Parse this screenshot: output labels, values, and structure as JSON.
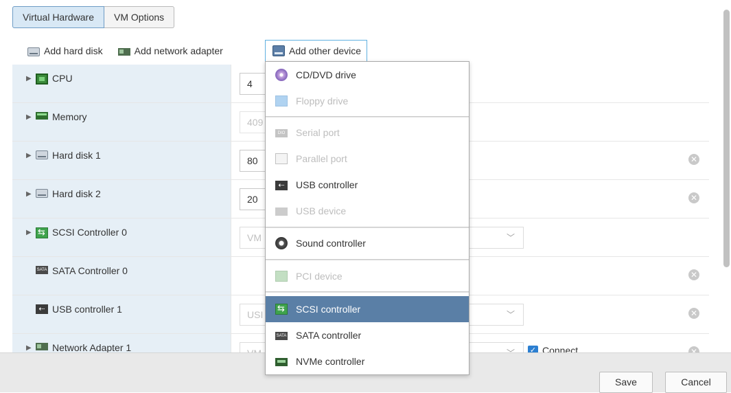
{
  "tabs": [
    {
      "label": "Virtual Hardware",
      "active": true
    },
    {
      "label": "VM Options",
      "active": false
    }
  ],
  "toolbar": {
    "add_hard_disk": "Add hard disk",
    "add_network_adapter": "Add network adapter",
    "add_other_device": "Add other device"
  },
  "hardware": [
    {
      "label": "CPU",
      "icon": "cpu-icon",
      "expandable": true,
      "value": "4"
    },
    {
      "label": "Memory",
      "icon": "memory-icon",
      "expandable": true,
      "value": "409"
    },
    {
      "label": "Hard disk 1",
      "icon": "hard-disk-icon",
      "expandable": true,
      "value": "80"
    },
    {
      "label": "Hard disk 2",
      "icon": "hard-disk-icon",
      "expandable": true,
      "value": "20"
    },
    {
      "label": "SCSI Controller 0",
      "icon": "scsi-icon",
      "expandable": true,
      "value": "VM"
    },
    {
      "label": "SATA Controller 0",
      "icon": "sata-icon",
      "expandable": false,
      "value": ""
    },
    {
      "label": "USB controller 1",
      "icon": "usb-icon",
      "expandable": false,
      "value": "USI"
    },
    {
      "label": "Network Adapter 1",
      "icon": "network-icon",
      "expandable": true,
      "value": "VM",
      "connect_label": "Connect"
    }
  ],
  "menu": {
    "items": [
      {
        "label": "CD/DVD drive",
        "icon": "cd-dvd-icon",
        "enabled": true
      },
      {
        "label": "Floppy drive",
        "icon": "floppy-icon",
        "enabled": false
      },
      {
        "label": "Serial port",
        "icon": "serial-port-icon",
        "enabled": false
      },
      {
        "label": "Parallel port",
        "icon": "parallel-port-icon",
        "enabled": false
      },
      {
        "label": "USB controller",
        "icon": "usb-icon",
        "enabled": true
      },
      {
        "label": "USB device",
        "icon": "usb-device-icon",
        "enabled": false
      },
      {
        "label": "Sound controller",
        "icon": "sound-icon",
        "enabled": true
      },
      {
        "label": "PCI device",
        "icon": "pci-icon",
        "enabled": false
      },
      {
        "label": "SCSI controller",
        "icon": "scsi-icon",
        "enabled": true,
        "selected": true
      },
      {
        "label": "SATA controller",
        "icon": "sata-icon",
        "enabled": true
      },
      {
        "label": "NVMe controller",
        "icon": "nvme-icon",
        "enabled": true
      }
    ]
  },
  "footer": {
    "save_label": "Save",
    "cancel_label": "Cancel"
  },
  "colors": {
    "accent": "#5a7fa6",
    "label_bg": "#e6eff6",
    "active_tab": "#d8e8f5"
  }
}
